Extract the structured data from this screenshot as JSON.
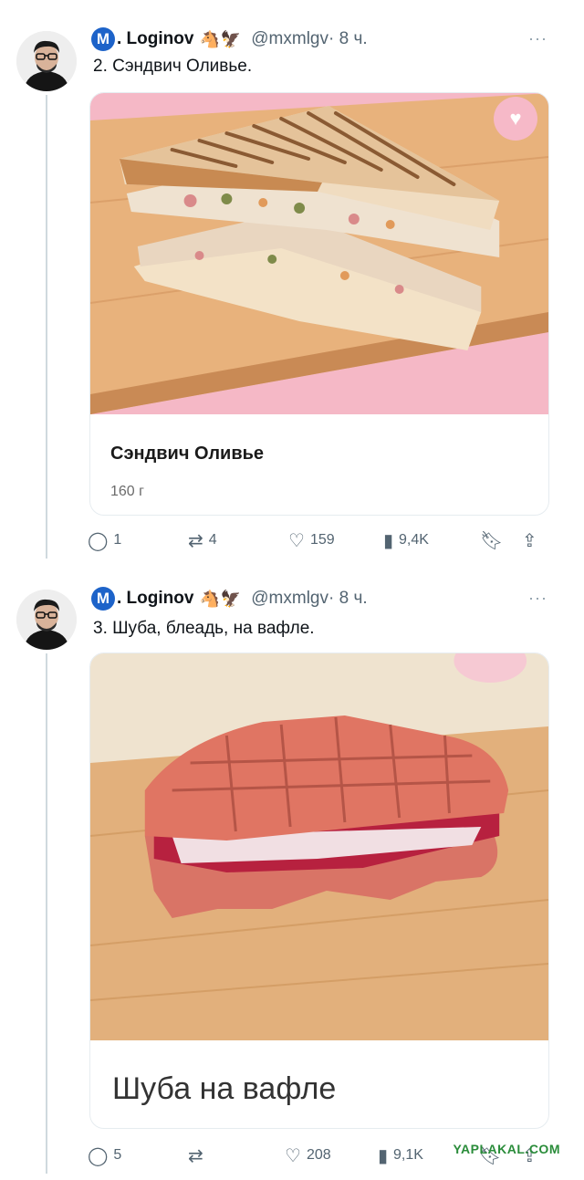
{
  "tweets": [
    {
      "author": {
        "badge": "M",
        "name": ". Loginov",
        "emojis": "🐴🦅",
        "handle": "@mxmlgv",
        "time": "· 8 ч."
      },
      "more": "···",
      "text": "2. Сэндвич Оливье.",
      "card": {
        "title": "Сэндвич Оливье",
        "weight": "160 г",
        "favorite_icon": "heart-icon"
      },
      "stats": {
        "replies": "1",
        "retweets": "4",
        "likes": "159",
        "views": "9,4K"
      }
    },
    {
      "author": {
        "badge": "M",
        "name": ". Loginov",
        "emojis": "🐴🦅",
        "handle": "@mxmlgv",
        "time": "· 8 ч."
      },
      "more": "···",
      "text": "3. Шуба, блеадь, на вафле.",
      "card": {
        "title": "Шуба на вафле"
      },
      "stats": {
        "replies": "5",
        "retweets": "",
        "likes": "208",
        "views": "9,1K"
      }
    }
  ],
  "watermark": "YAPLAKAL.COM",
  "colors": {
    "badge": "#1d63c9",
    "text_secondary": "#536471",
    "card_pink": "#f5b8c6",
    "board": "#e6b07a"
  }
}
